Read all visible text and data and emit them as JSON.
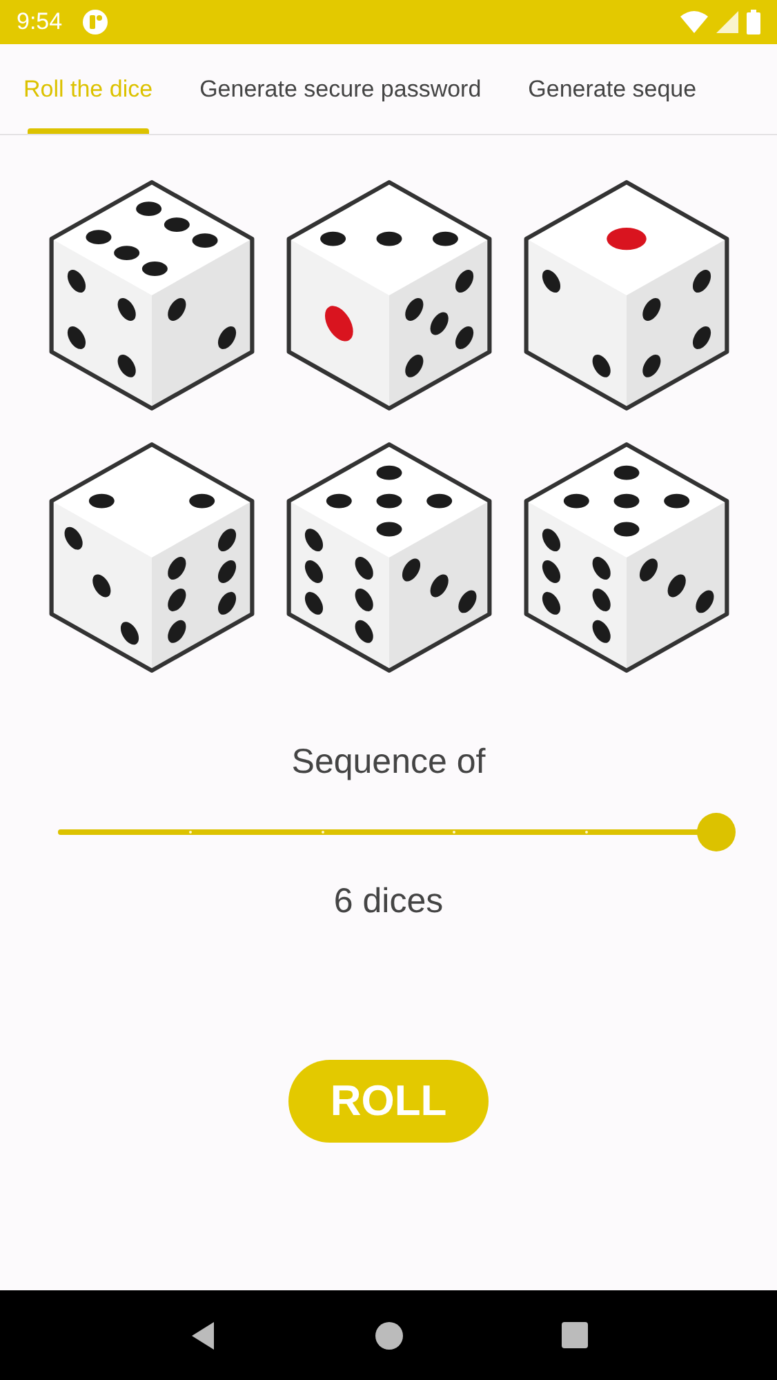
{
  "status_bar": {
    "time": "9:54"
  },
  "tabs": [
    {
      "label": "Roll the dice",
      "selected": true
    },
    {
      "label": "Generate secure password",
      "selected": false
    },
    {
      "label": "Generate seque",
      "selected": false
    }
  ],
  "sequence": {
    "label": "Sequence of",
    "level": 1,
    "reading": "6 dices"
  },
  "roll_button": "ROLL"
}
